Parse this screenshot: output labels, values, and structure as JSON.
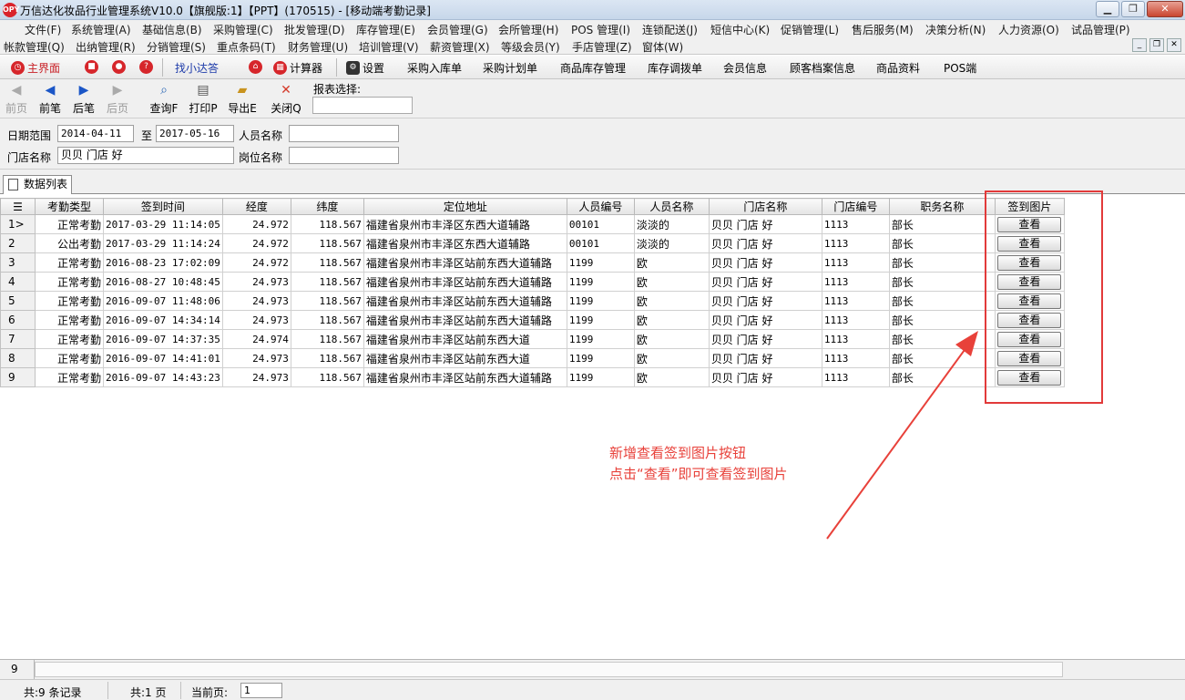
{
  "window": {
    "logo_text": "OPY",
    "title": "万信达化妆品行业管理系统V10.0【旗舰版:1】【PPT】(170515) - [移动端考勤记录]",
    "minimize": "▁",
    "maximize": "❐",
    "close": "✕"
  },
  "menu_row1": [
    "文件(F)",
    "系统管理(A)",
    "基础信息(B)",
    "采购管理(C)",
    "批发管理(D)",
    "库存管理(E)",
    "会员管理(G)",
    "会所管理(H)",
    "POS 管理(I)",
    "连锁配送(J)",
    "短信中心(K)",
    "促销管理(L)",
    "售后服务(M)",
    "决策分析(N)",
    "人力资源(O)",
    "试品管理(P)"
  ],
  "menu_row2": [
    "帐款管理(Q)",
    "出纳管理(R)",
    "分销管理(S)",
    "重点条码(T)",
    "财务管理(U)",
    "培训管理(V)",
    "薪资管理(X)",
    "等级会员(Y)",
    "手店管理(Z)",
    "窗体(W)"
  ],
  "mdi": {
    "minimize": "_",
    "restore": "❐",
    "close": "✕"
  },
  "quickbar": {
    "home": "主界面",
    "find": "找小达答",
    "calculator": "计算器",
    "settings": "设置",
    "links": [
      "采购入库单",
      "采购计划单",
      "商品库存管理",
      "库存调拨单",
      "会员信息",
      "顾客档案信息",
      "商品资料",
      "POS端"
    ]
  },
  "toolbar": {
    "first": "前页",
    "prev": "前笔",
    "next": "后笔",
    "last": "后页",
    "query": "查询F",
    "print": "打印P",
    "export": "导出E",
    "close": "关闭Q",
    "report_label": "报表选择:",
    "report_value": ""
  },
  "filter": {
    "date_label": "日期范围",
    "date_from": "2014-04-11",
    "to_label": "至",
    "date_to": "2017-05-16",
    "person_label": "人员名称",
    "person_value": "",
    "store_label": "门店名称",
    "store_value": "贝贝 门店 好",
    "post_label": "岗位名称",
    "post_value": ""
  },
  "tab": {
    "label": "数据列表"
  },
  "table": {
    "columns": [
      "考勤类型",
      "签到时间",
      "经度",
      "纬度",
      "定位地址",
      "人员编号",
      "人员名称",
      "门店名称",
      "门店编号",
      "职务名称",
      "签到图片"
    ],
    "view_label": "查看",
    "rows": [
      {
        "ind": "1>",
        "type": "正常考勤",
        "time": "2017-03-29 11:14:05",
        "lng": "24.972",
        "lat": "118.567",
        "addr": "福建省泉州市丰泽区东西大道辅路",
        "pid": "00101",
        "pname": "淡淡的",
        "store": "贝贝 门店 好",
        "sid": "1113",
        "post": "部长"
      },
      {
        "ind": "2",
        "type": "公出考勤",
        "time": "2017-03-29 11:14:24",
        "lng": "24.972",
        "lat": "118.567",
        "addr": "福建省泉州市丰泽区东西大道辅路",
        "pid": "00101",
        "pname": "淡淡的",
        "store": "贝贝 门店 好",
        "sid": "1113",
        "post": "部长"
      },
      {
        "ind": "3",
        "type": "正常考勤",
        "time": "2016-08-23 17:02:09",
        "lng": "24.972",
        "lat": "118.567",
        "addr": "福建省泉州市丰泽区站前东西大道辅路",
        "pid": "1199",
        "pname": "欧",
        "store": "贝贝 门店 好",
        "sid": "1113",
        "post": "部长"
      },
      {
        "ind": "4",
        "type": "正常考勤",
        "time": "2016-08-27 10:48:45",
        "lng": "24.973",
        "lat": "118.567",
        "addr": "福建省泉州市丰泽区站前东西大道辅路",
        "pid": "1199",
        "pname": "欧",
        "store": "贝贝 门店 好",
        "sid": "1113",
        "post": "部长"
      },
      {
        "ind": "5",
        "type": "正常考勤",
        "time": "2016-09-07 11:48:06",
        "lng": "24.973",
        "lat": "118.567",
        "addr": "福建省泉州市丰泽区站前东西大道辅路",
        "pid": "1199",
        "pname": "欧",
        "store": "贝贝 门店 好",
        "sid": "1113",
        "post": "部长"
      },
      {
        "ind": "6",
        "type": "正常考勤",
        "time": "2016-09-07 14:34:14",
        "lng": "24.973",
        "lat": "118.567",
        "addr": "福建省泉州市丰泽区站前东西大道辅路",
        "pid": "1199",
        "pname": "欧",
        "store": "贝贝 门店 好",
        "sid": "1113",
        "post": "部长"
      },
      {
        "ind": "7",
        "type": "正常考勤",
        "time": "2016-09-07 14:37:35",
        "lng": "24.974",
        "lat": "118.567",
        "addr": "福建省泉州市丰泽区站前东西大道",
        "pid": "1199",
        "pname": "欧",
        "store": "贝贝 门店 好",
        "sid": "1113",
        "post": "部长"
      },
      {
        "ind": "8",
        "type": "正常考勤",
        "time": "2016-09-07 14:41:01",
        "lng": "24.973",
        "lat": "118.567",
        "addr": "福建省泉州市丰泽区站前东西大道",
        "pid": "1199",
        "pname": "欧",
        "store": "贝贝 门店 好",
        "sid": "1113",
        "post": "部长"
      },
      {
        "ind": "9",
        "type": "正常考勤",
        "time": "2016-09-07 14:43:23",
        "lng": "24.973",
        "lat": "118.567",
        "addr": "福建省泉州市丰泽区站前东西大道辅路",
        "pid": "1199",
        "pname": "欧",
        "store": "贝贝 门店 好",
        "sid": "1113",
        "post": "部长"
      }
    ]
  },
  "annotation": {
    "line1": "新增查看签到图片按钮",
    "line2": "点击“查看”即可查看签到图片",
    "color": "#e8413a"
  },
  "footer": {
    "row_count": "9"
  },
  "status": {
    "total": "共:9 条记录",
    "pages": "共:1 页",
    "current_label": "当前页:",
    "current_value": "1"
  }
}
